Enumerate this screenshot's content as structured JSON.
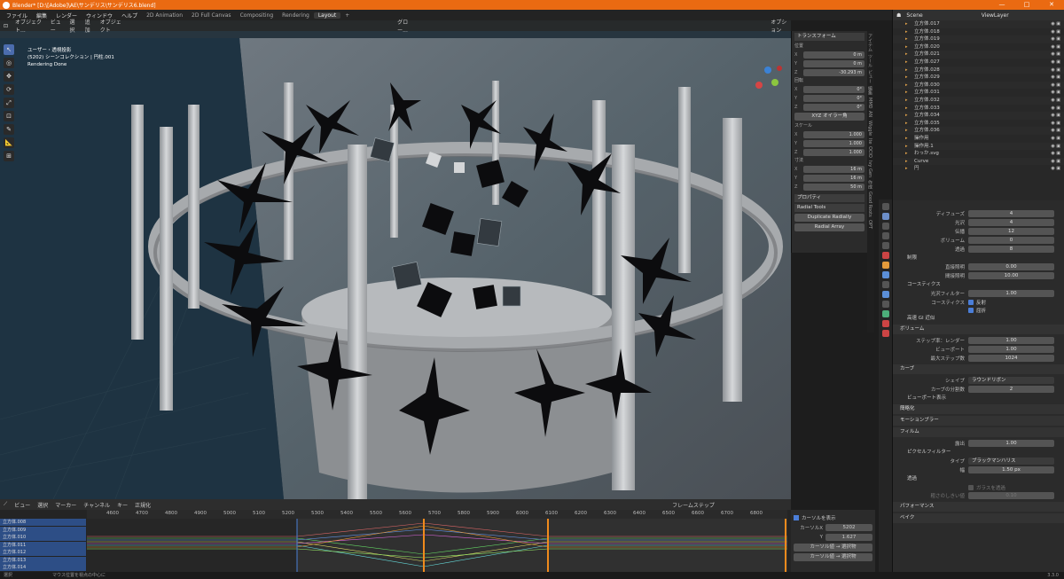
{
  "window": {
    "title": "Blender* [D:\\[Adobe]\\AE\\サンデリス\\サンデリス6.blend]",
    "ctl_min": "—",
    "ctl_max": "□",
    "ctl_close": "✕"
  },
  "menu": {
    "items": [
      "ファイル",
      "編集",
      "レンダー",
      "ウィンドウ",
      "ヘルプ"
    ],
    "workspaces": [
      "2D Animation",
      "2D Full Canvas",
      "Compositing",
      "Rendering",
      "Layout",
      "+"
    ]
  },
  "viewport": {
    "header_items": [
      "オブジェクト...",
      "ビュー",
      "選択",
      "追加",
      "オブジェクト"
    ],
    "shading": "グロー...",
    "info": [
      "ユーザー・透視投影",
      "(5202) シーンコレクション | 円柱.001",
      "Rendering Done"
    ],
    "options_label": "オプション"
  },
  "toolbar": {
    "icons": [
      "↖",
      "◎",
      "✥",
      "⟳",
      "⤢",
      "⊡",
      "✎",
      "📐",
      "⊞"
    ]
  },
  "npanel": {
    "transform_title": "トランスフォーム",
    "location_label": "位置",
    "loc": [
      {
        "k": "X",
        "v": "0 m"
      },
      {
        "k": "Y",
        "v": "0 m"
      },
      {
        "k": "Z",
        "v": "-30.293 m"
      }
    ],
    "rotation_label": "回転",
    "rot": [
      {
        "k": "X",
        "v": "0°"
      },
      {
        "k": "Y",
        "v": "0°"
      },
      {
        "k": "Z",
        "v": "0°"
      }
    ],
    "rot_mode": "XYZ オイラー角",
    "scale_label": "スケール",
    "scale": [
      {
        "k": "X",
        "v": "1.000"
      },
      {
        "k": "Y",
        "v": "1.000"
      },
      {
        "k": "Z",
        "v": "1.000"
      }
    ],
    "dim_label": "寸法",
    "dims": [
      {
        "k": "X",
        "v": "16 m"
      },
      {
        "k": "Y",
        "v": "16 m"
      },
      {
        "k": "Z",
        "v": "50 m"
      }
    ],
    "properties_title": "プロパティ",
    "radial_title": "Radial Tools",
    "btn_dup": "Duplicate Radially",
    "btn_array": "Radial Array"
  },
  "ntabs": [
    "アイテム",
    "ツール",
    "ビュー",
    "編集",
    "MMD",
    "AN",
    "Wiggle",
    "Ite",
    "OCIO",
    "Ivy Gen",
    "作成",
    "Good Roots",
    "OPT"
  ],
  "outliner": {
    "scene": "Scene",
    "viewlayer": "ViewLayer",
    "items": [
      "立方体.017",
      "立方体.018",
      "立方体.019",
      "立方体.020",
      "立方体.021",
      "立方体.027",
      "立方体.028",
      "立方体.029",
      "立方体.030",
      "立方体.031",
      "立方体.032",
      "立方体.033",
      "立方体.034",
      "立方体.035",
      "立方体.036",
      "操作用",
      "操作用.1",
      "わっか.svg",
      "Curve",
      "円"
    ]
  },
  "props": {
    "rows1": [
      {
        "k": "ディフューズ",
        "v": "4"
      },
      {
        "k": "光沢",
        "v": "4"
      },
      {
        "k": "伝播",
        "v": "12"
      },
      {
        "k": "ボリューム",
        "v": "0"
      },
      {
        "k": "透過",
        "v": "8"
      }
    ],
    "clamp_title": "制限",
    "clamp": [
      {
        "k": "直接照明",
        "v": "0.00"
      },
      {
        "k": "間接照明",
        "v": "10.00"
      }
    ],
    "caustics_title": "コースティクス",
    "filter": {
      "k": "光沢フィルター",
      "v": "1.00"
    },
    "caustics_label": "コースティクス",
    "reflect": "反射",
    "refract": "屈折",
    "fastgi": "高速 GI 近似",
    "volume_title": "ボリューム",
    "volume": [
      {
        "k": "ステップ率：レンダー",
        "v": "1.00"
      },
      {
        "k": "ビューポート",
        "v": "1.00"
      },
      {
        "k": "最大ステップ数",
        "v": "1024"
      }
    ],
    "curve_title": "カーブ",
    "shape": {
      "k": "シェイプ",
      "v": "ラウンドリボン"
    },
    "subdiv": {
      "k": "カーブの分割数",
      "v": "2"
    },
    "viewport_disp": "ビューポート表示",
    "simplify": "簡略化",
    "motion_blur": "モーションブラー",
    "film_title": "フィルム",
    "exposure": {
      "k": "露出",
      "v": "1.00"
    },
    "pixel_filter": "ピクセルフィルター",
    "ftype": {
      "k": "タイプ",
      "v": "ブラックマンハリス"
    },
    "width": {
      "k": "幅",
      "v": "1.50 px"
    },
    "transparent": "透過",
    "glass": "ガラスを透過",
    "roughness": {
      "k": "粗さのしきい値",
      "v": "0.10"
    },
    "performance": "パフォーマンス",
    "bake": "ベイク"
  },
  "timeline": {
    "header_items": [
      "ビュー",
      "選択",
      "マーカー",
      "チャンネル",
      "キー",
      "正規化"
    ],
    "frame_step": "フレームステップ",
    "ticks": [
      "4600",
      "4700",
      "4800",
      "4900",
      "5000",
      "5100",
      "5200",
      "5300",
      "5400",
      "5500",
      "5600",
      "5700",
      "5800",
      "5900",
      "6000",
      "6100",
      "6200",
      "6300",
      "6400",
      "6500",
      "6600",
      "6700",
      "6800"
    ],
    "current": "5202",
    "channels": [
      "立方体.008",
      "立方体.009",
      "立方体.010",
      "立方体.011",
      "立方体.012",
      "立方体.013",
      "立方体.014"
    ],
    "side_title": "カーソルを表示",
    "cursor_x": {
      "k": "カーソルX",
      "v": "5202"
    },
    "cursor_y": {
      "k": "Y",
      "v": "1.627"
    },
    "btn1": "カーソル値 → 選択物",
    "btn2": "カーソル値 → 選択物"
  },
  "status": {
    "text": "選択　　　　　　　　　マウス位置を視点の中心に",
    "version": "3.3.0"
  }
}
